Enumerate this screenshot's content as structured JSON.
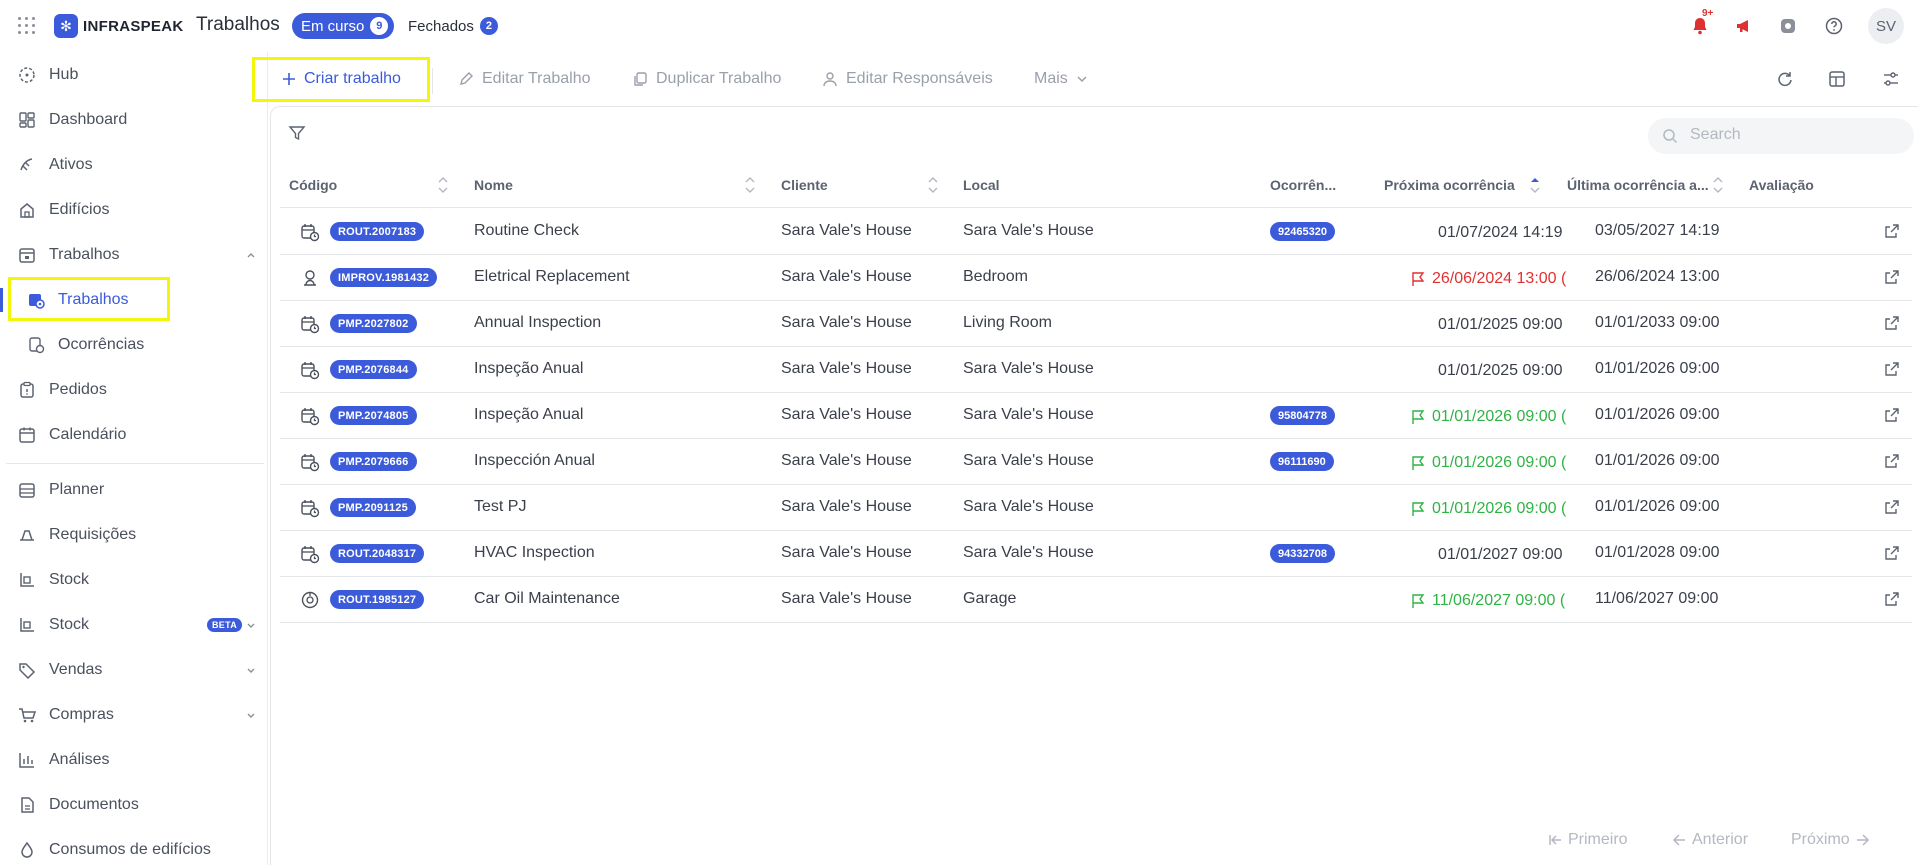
{
  "app": {
    "brand": "INFRASPEAK",
    "page_title": "Trabalhos",
    "tabs": [
      {
        "label": "Em curso",
        "count": "9"
      },
      {
        "label": "Fechados",
        "count": "2"
      }
    ],
    "notification_count": "9+",
    "user_initials": "SV"
  },
  "sidebar": {
    "items": [
      {
        "label": "Hub",
        "icon": "hub-icon"
      },
      {
        "label": "Dashboard",
        "icon": "dashboard-icon"
      },
      {
        "label": "Ativos",
        "icon": "assets-icon"
      },
      {
        "label": "Edifícios",
        "icon": "building-icon"
      },
      {
        "label": "Trabalhos",
        "icon": "calendar-work-icon"
      },
      {
        "label": "Trabalhos",
        "icon": "calendar-settings-icon"
      },
      {
        "label": "Ocorrências",
        "icon": "occurrence-icon"
      },
      {
        "label": "Pedidos",
        "icon": "clipboard-icon"
      },
      {
        "label": "Calendário",
        "icon": "calendar-icon"
      },
      {
        "label": "Planner",
        "icon": "planner-icon"
      },
      {
        "label": "Requisições",
        "icon": "requisitions-icon"
      },
      {
        "label": "Stock",
        "icon": "stock-icon"
      },
      {
        "label": "Stock",
        "icon": "stock-icon",
        "badge": "BETA"
      },
      {
        "label": "Vendas",
        "icon": "tag-icon"
      },
      {
        "label": "Compras",
        "icon": "cart-icon"
      },
      {
        "label": "Análises",
        "icon": "chart-icon"
      },
      {
        "label": "Documentos",
        "icon": "document-icon"
      },
      {
        "label": "Consumos de edifícios",
        "icon": "consumption-icon"
      }
    ]
  },
  "toolbar": {
    "create": "Criar trabalho",
    "edit": "Editar Trabalho",
    "duplicate": "Duplicar Trabalho",
    "edit_responsibles": "Editar Responsáveis",
    "more": "Mais"
  },
  "search": {
    "placeholder": "Search"
  },
  "table": {
    "columns": [
      "Código",
      "Nome",
      "Cliente",
      "Local",
      "Ocorrên...",
      "Próxima ocorrência",
      "Última ocorrência a...",
      "Avaliação"
    ],
    "rows": [
      {
        "code": "ROUT.2007183",
        "name": "Routine Check",
        "client": "Sara Vale's House",
        "local": "Sara Vale's House",
        "occurrence": "92465320",
        "next": "01/07/2024 14:19",
        "next_status": "plain",
        "last": "03/05/2027 14:19",
        "type_icon": "calendar-clock-icon"
      },
      {
        "code": "IMPROV.1981432",
        "name": "Eletrical Replacement",
        "client": "Sara Vale's House",
        "local": "Bedroom",
        "occurrence": "",
        "next": "26/06/2024 13:00 (",
        "next_status": "red",
        "last": "26/06/2024 13:00",
        "type_icon": "improvement-icon"
      },
      {
        "code": "PMP.2027802",
        "name": "Annual Inspection",
        "client": "Sara Vale's House",
        "local": "Living Room",
        "occurrence": "",
        "next": "01/01/2025 09:00",
        "next_status": "plain",
        "last": "01/01/2033 09:00",
        "type_icon": "calendar-clock-icon"
      },
      {
        "code": "PMP.2076844",
        "name": "Inspeção Anual",
        "client": "Sara Vale's House",
        "local": "Sara Vale's House",
        "occurrence": "",
        "next": "01/01/2025 09:00",
        "next_status": "plain",
        "last": "01/01/2026 09:00",
        "type_icon": "calendar-clock-icon"
      },
      {
        "code": "PMP.2074805",
        "name": "Inspeção Anual",
        "client": "Sara Vale's House",
        "local": "Sara Vale's House",
        "occurrence": "95804778",
        "next": "01/01/2026 09:00 (",
        "next_status": "green",
        "last": "01/01/2026 09:00",
        "type_icon": "calendar-clock-icon"
      },
      {
        "code": "PMP.2079666",
        "name": "Inspección Anual",
        "client": "Sara Vale's House",
        "local": "Sara Vale's House",
        "occurrence": "96111690",
        "next": "01/01/2026 09:00 (",
        "next_status": "green",
        "last": "01/01/2026 09:00",
        "type_icon": "calendar-clock-icon"
      },
      {
        "code": "PMP.2091125",
        "name": "Test PJ",
        "client": "Sara Vale's House",
        "local": "Sara Vale's House",
        "occurrence": "",
        "next": "01/01/2026 09:00 (",
        "next_status": "green",
        "last": "01/01/2026 09:00",
        "type_icon": "calendar-clock-icon"
      },
      {
        "code": "ROUT.2048317",
        "name": "HVAC Inspection",
        "client": "Sara Vale's House",
        "local": "Sara Vale's House",
        "occurrence": "94332708",
        "next": "01/01/2027 09:00",
        "next_status": "plain",
        "last": "01/01/2028 09:00",
        "type_icon": "calendar-clock-icon"
      },
      {
        "code": "ROUT.1985127",
        "name": "Car Oil Maintenance",
        "client": "Sara Vale's House",
        "local": "Garage",
        "occurrence": "",
        "next": "11/06/2027 09:00 (",
        "next_status": "green",
        "last": "11/06/2027 09:00",
        "type_icon": "gauge-icon"
      }
    ]
  },
  "pagination": {
    "first": "Primeiro",
    "previous": "Anterior",
    "next": "Próximo"
  },
  "colors": {
    "accent": "#3b5bdb",
    "highlight": "#f5f50a",
    "overdue": "#e03131",
    "on_track": "#2fb344"
  }
}
